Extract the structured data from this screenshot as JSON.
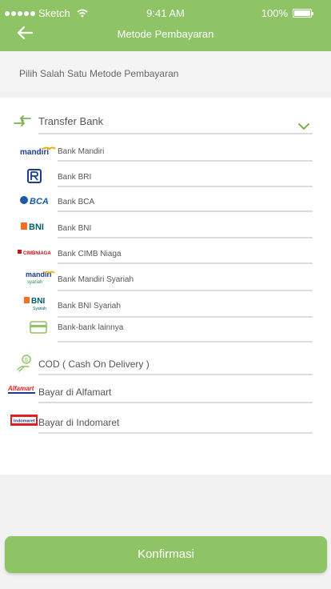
{
  "status_bar": {
    "carrier": "Sketch",
    "time": "9:41 AM",
    "battery": "100%"
  },
  "nav": {
    "title": "Metode Pembayaran"
  },
  "instruction": "Pilih Salah Satu Metode Pembayaran",
  "transfer": {
    "label": "Transfer Bank",
    "banks": [
      {
        "label": "Bank Mandiri",
        "logo_text": "mandiri"
      },
      {
        "label": "Bank BRI",
        "logo_text": ""
      },
      {
        "label": "Bank BCA",
        "logo_text": "BCA"
      },
      {
        "label": "Bank BNI",
        "logo_text": "BNI"
      },
      {
        "label": "Bank CIMB Niaga",
        "logo_text": "CIMBNIAGA"
      },
      {
        "label": "Bank Mandiri Syariah",
        "logo_text": "mandiri",
        "logo_subtext": "syariah"
      },
      {
        "label": "Bank BNI Syariah",
        "logo_text": "BNI",
        "logo_subtext": "Syariah"
      },
      {
        "label": "Bank-bank lainnya",
        "logo_text": ""
      }
    ]
  },
  "cod": {
    "label": "COD ( Cash On Delivery )"
  },
  "alfamart": {
    "label": "Bayar di Alfamart",
    "logo_text": "Alfamart"
  },
  "indomaret": {
    "label": "Bayar di Indomaret",
    "logo_text": "Indomaret"
  },
  "confirm_label": "Konfirmasi",
  "colors": {
    "accent": "#8ec465",
    "divider": "#dcdcdc",
    "text": "#555555"
  }
}
